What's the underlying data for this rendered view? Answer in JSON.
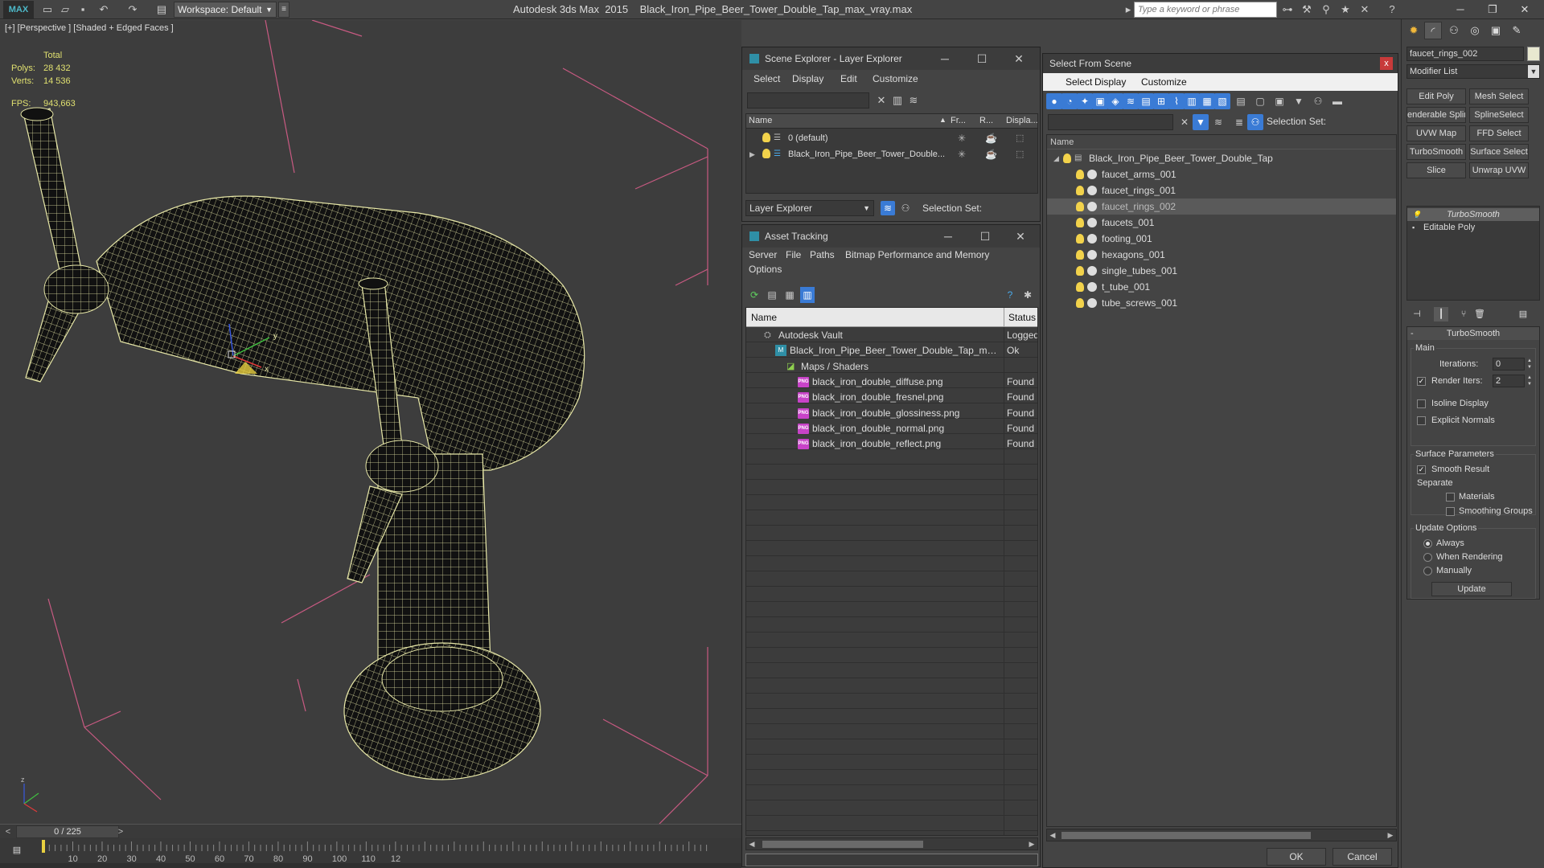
{
  "titlebar": {
    "logo": "MAX",
    "workspace": "Workspace: Default",
    "app_name": "Autodesk 3ds Max",
    "version": "2015",
    "file_name": "Black_Iron_Pipe_Beer_Tower_Double_Tap_max_vray.max",
    "search_placeholder": "Type a keyword or phrase"
  },
  "viewport": {
    "label": "[+] [Perspective ] [Shaded + Edged Faces ]",
    "stats": {
      "total_label": "Total",
      "polys_label": "Polys:",
      "polys": "28 432",
      "verts_label": "Verts:",
      "verts": "14 536",
      "fps_label": "FPS:",
      "fps": "943,663"
    },
    "axis": {
      "x": "x",
      "y": "y",
      "z": "z"
    }
  },
  "timeline": {
    "frame": "0 / 225",
    "ticks": [
      "10",
      "20",
      "30",
      "40",
      "50",
      "60",
      "70",
      "80",
      "90",
      "100",
      "110",
      "12"
    ]
  },
  "scene_explorer": {
    "title": "Scene Explorer - Layer Explorer",
    "menu": [
      "Select",
      "Display",
      "Edit",
      "Customize"
    ],
    "columns": [
      "Name",
      "Fr...",
      "R...",
      "Displa..."
    ],
    "rows": [
      {
        "name": "0 (default)"
      },
      {
        "name": "Black_Iron_Pipe_Beer_Tower_Double..."
      }
    ],
    "footer_dropdown": "Layer Explorer",
    "selection_set": "Selection Set:"
  },
  "asset_tracking": {
    "title": "Asset Tracking",
    "menu": [
      "Server",
      "File",
      "Paths",
      "Bitmap Performance and Memory"
    ],
    "menu2": "Options",
    "columns": {
      "name": "Name",
      "status": "Status"
    },
    "rows": [
      {
        "name": "Autodesk Vault",
        "status": "Logged"
      },
      {
        "name": "Black_Iron_Pipe_Beer_Tower_Double_Tap_max_v...",
        "status": "Ok"
      },
      {
        "name": "Maps / Shaders",
        "status": ""
      },
      {
        "name": "black_iron_double_diffuse.png",
        "status": "Found"
      },
      {
        "name": "black_iron_double_fresnel.png",
        "status": "Found"
      },
      {
        "name": "black_iron_double_glossiness.png",
        "status": "Found"
      },
      {
        "name": "black_iron_double_normal.png",
        "status": "Found"
      },
      {
        "name": "black_iron_double_reflect.png",
        "status": "Found"
      }
    ],
    "file_badge": "PNG"
  },
  "select_from_scene": {
    "title": "Select From Scene",
    "close": "x",
    "menu": [
      "Select",
      "Display",
      "Customize"
    ],
    "selection_set": "Selection Set:",
    "column": "Name",
    "root": "Black_Iron_Pipe_Beer_Tower_Double_Tap",
    "items": [
      "faucet_arms_001",
      "faucet_rings_001",
      "faucet_rings_002",
      "faucets_001",
      "footing_001",
      "hexagons_001",
      "single_tubes_001",
      "t_tube_001",
      "tube_screws_001"
    ],
    "ok": "OK",
    "cancel": "Cancel"
  },
  "command_panel": {
    "object_name": "faucet_rings_002",
    "modifier_list": "Modifier List",
    "buttons": [
      "Edit Poly",
      "Mesh Select",
      "enderable Splir",
      "SplineSelect",
      "UVW Map",
      "FFD Select",
      "TurboSmooth",
      "Surface Select",
      "Slice",
      "Unwrap UVW"
    ],
    "stack": [
      "TurboSmooth",
      "Editable Poly"
    ],
    "rollout": {
      "title": "TurboSmooth",
      "main": "Main",
      "iterations_label": "Iterations:",
      "iterations": "0",
      "render_iters_label": "Render Iters:",
      "render_iters": "2",
      "isoline": "Isoline Display",
      "explicit_normals": "Explicit Normals",
      "surface_params": "Surface Parameters",
      "smooth_result": "Smooth Result",
      "separate": "Separate",
      "materials": "Materials",
      "smoothing_groups": "Smoothing Groups",
      "update_options": "Update Options",
      "always": "Always",
      "when_rendering": "When Rendering",
      "manually": "Manually",
      "update": "Update"
    }
  },
  "colors": {
    "wire": "#e8e8a8",
    "bbox": "#c85a82",
    "accent": "#3a7bd5",
    "selected": "#1b5fd1"
  }
}
